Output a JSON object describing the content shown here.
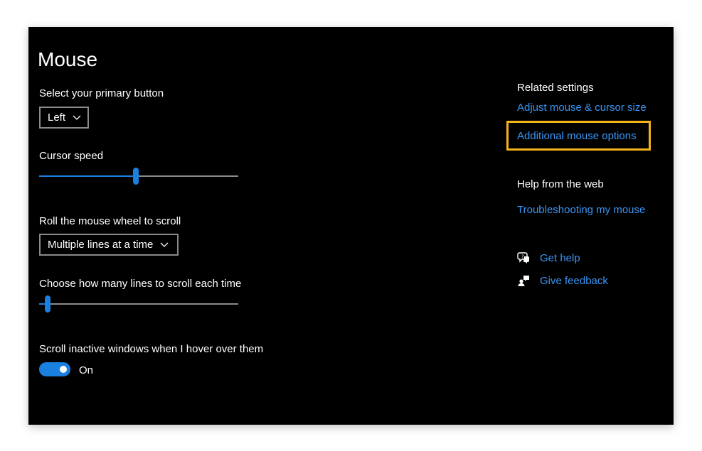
{
  "page": {
    "title": "Mouse"
  },
  "primary_button": {
    "label": "Select your primary button",
    "value": "Left"
  },
  "cursor_speed": {
    "label": "Cursor speed",
    "value_fraction": 0.47
  },
  "wheel_scroll": {
    "label": "Roll the mouse wheel to scroll",
    "value": "Multiple lines at a time"
  },
  "scroll_lines": {
    "label": "Choose how many lines to scroll each time",
    "value_fraction": 0.03
  },
  "inactive_scroll": {
    "label": "Scroll inactive windows when I hover over them",
    "state": "On"
  },
  "related": {
    "heading": "Related settings",
    "links": [
      "Adjust mouse & cursor size",
      "Additional mouse options"
    ]
  },
  "help_web": {
    "heading": "Help from the web",
    "link": "Troubleshooting my mouse"
  },
  "support": {
    "get_help": "Get help",
    "give_feedback": "Give feedback"
  },
  "colors": {
    "accent": "#1a80e0",
    "link": "#3a95f3",
    "highlight": "#f5b21b",
    "background": "#000000"
  },
  "icons": [
    "chevron-down-icon",
    "get-help-icon",
    "give-feedback-icon"
  ]
}
